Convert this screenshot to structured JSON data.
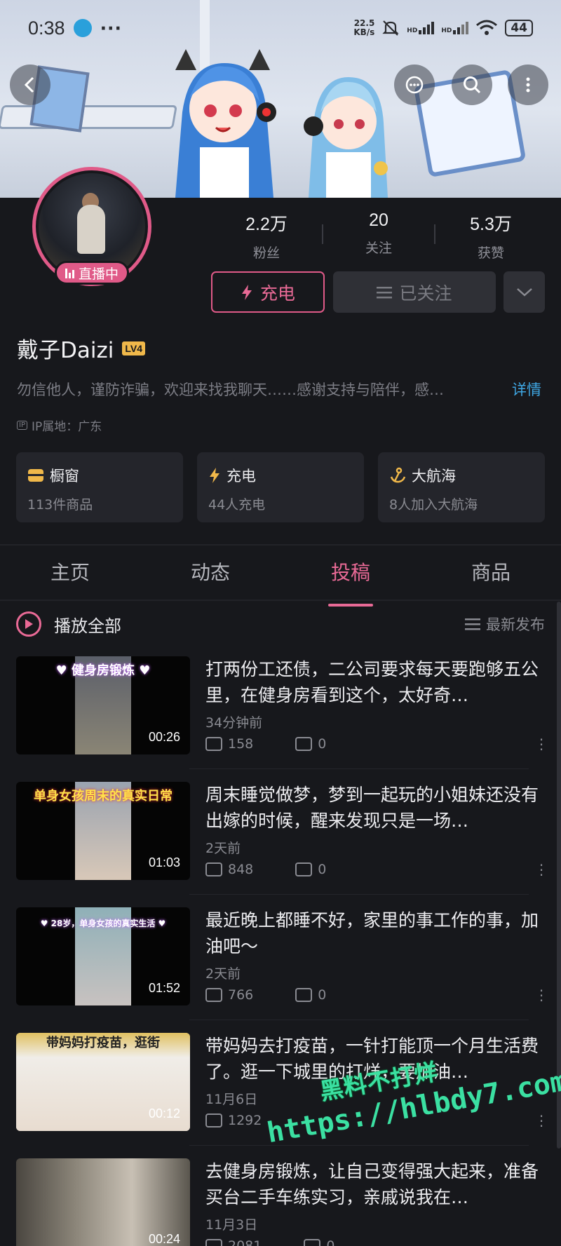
{
  "status_bar": {
    "time": "0:38",
    "more": "···",
    "net_speed_top": "22.5",
    "net_speed_unit": "KB/s",
    "signal1": "HD",
    "signal2": "HD",
    "battery": "44"
  },
  "profile": {
    "live_badge": "直播中",
    "stats": [
      {
        "value": "2.2万",
        "label": "粉丝"
      },
      {
        "value": "20",
        "label": "关注"
      },
      {
        "value": "5.3万",
        "label": "获赞"
      }
    ],
    "charge_button": "充电",
    "follow_button": "已关注",
    "name": "戴子Daizi",
    "level": "LV4",
    "bio": "勿信他人，谨防诈骗，欢迎来找我聊天……感谢支持与陪伴，感…",
    "detail_link": "详情",
    "ip_tag": "IP",
    "ip_location": "IP属地：广东"
  },
  "cards": [
    {
      "title": "橱窗",
      "sub": "113件商品",
      "color": "#f0b84a"
    },
    {
      "title": "充电",
      "sub": "44人充电",
      "color": "#f0b84a"
    },
    {
      "title": "大航海",
      "sub": "8人加入大航海",
      "color": "#f0b84a"
    }
  ],
  "tabs": [
    "主页",
    "动态",
    "投稿",
    "商品"
  ],
  "list": {
    "play_all": "播放全部",
    "sort": "最新发布"
  },
  "videos": [
    {
      "caption": "♥ 健身房锻炼 ♥",
      "duration": "00:26",
      "title": "打两份工还债，二公司要求每天要跑够五公里，在健身房看到这个，太好奇…",
      "date": "34分钟前",
      "plays": "158",
      "danmaku": "0"
    },
    {
      "caption": "单身女孩周末的真实日常",
      "duration": "01:03",
      "title": "周末睡觉做梦，梦到一起玩的小姐妹还没有出嫁的时候，醒来发现只是一场…",
      "date": "2天前",
      "plays": "848",
      "danmaku": "0"
    },
    {
      "caption": "♥ 28岁，单身女孩的真实生活 ♥",
      "duration": "01:52",
      "title": "最近晚上都睡不好，家里的事工作的事，加油吧～",
      "date": "2天前",
      "plays": "766",
      "danmaku": "0"
    },
    {
      "caption": "带妈妈打疫苗，逛街",
      "duration": "00:12",
      "title": "带妈妈去打疫苗，一针打能顶一个月生活费了。逛一下城里的打烊，要加油…",
      "date": "11月6日",
      "plays": "1292",
      "danmaku": ""
    },
    {
      "caption": "",
      "duration": "00:24",
      "title": "去健身房锻炼，让自己变得强大起来，准备买台二手车练实习，亲戚说我在…",
      "date": "11月3日",
      "plays": "2081",
      "danmaku": "0"
    }
  ],
  "watermark": {
    "line1": "黑料不打烊",
    "line2": "https://hlbdy7.com"
  },
  "colors": {
    "accent": "#e96a96",
    "background": "#17181c",
    "link": "#3fa7e4",
    "watermark": "#3be0a2"
  }
}
